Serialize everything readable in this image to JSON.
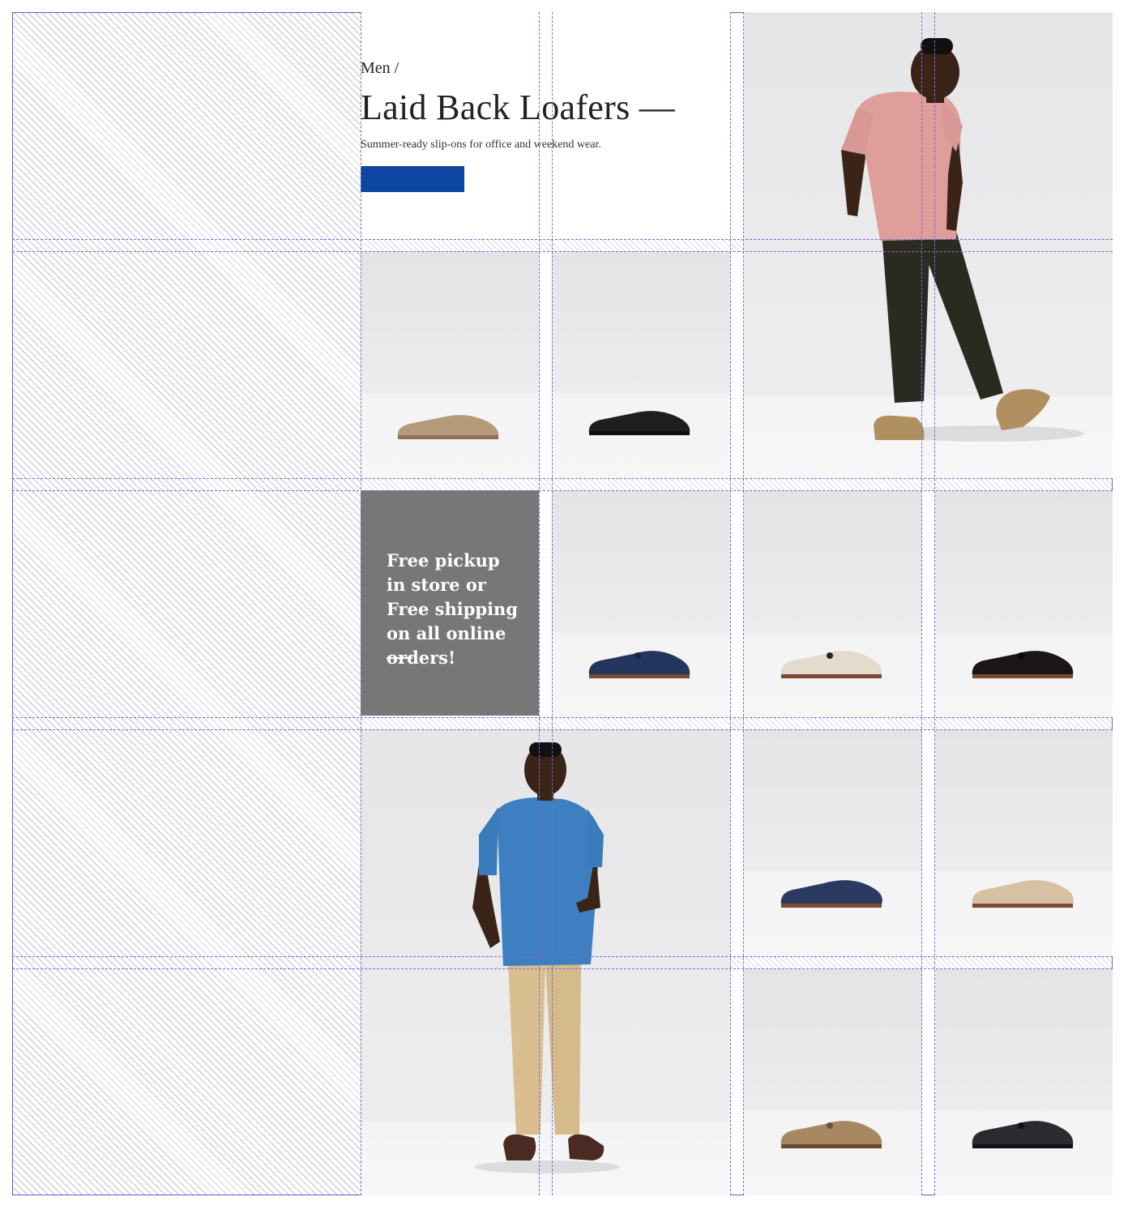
{
  "header": {
    "breadcrumb": "Men /",
    "title": "Laid Back Loafers —",
    "subtitle": "Summer-ready slip-ons for office and weekend wear.",
    "cta_label": ""
  },
  "promo": {
    "text": "Free pickup in store or Free shipping on all online orders!"
  },
  "colors": {
    "cta": "#0c46a0",
    "promo_bg": "#777777",
    "guide": "#6a5ad0"
  },
  "products": [
    {
      "name": "tan suede mule",
      "color": "#b59a7a"
    },
    {
      "name": "black leather mule",
      "color": "#1e1e1e"
    },
    {
      "name": "navy suede tassel loafer",
      "color": "#25365e"
    },
    {
      "name": "cream suede tassel loafer",
      "color": "#e3dccd"
    },
    {
      "name": "black suede tassel loafer",
      "color": "#1a1616"
    },
    {
      "name": "navy suede smoking slipper",
      "color": "#2a3a60"
    },
    {
      "name": "beige suede smoking slipper",
      "color": "#d8c0a2"
    },
    {
      "name": "taupe suede tassel loafer",
      "color": "#a78863"
    },
    {
      "name": "black leather tassel loafer",
      "color": "#2a2b30"
    }
  ]
}
